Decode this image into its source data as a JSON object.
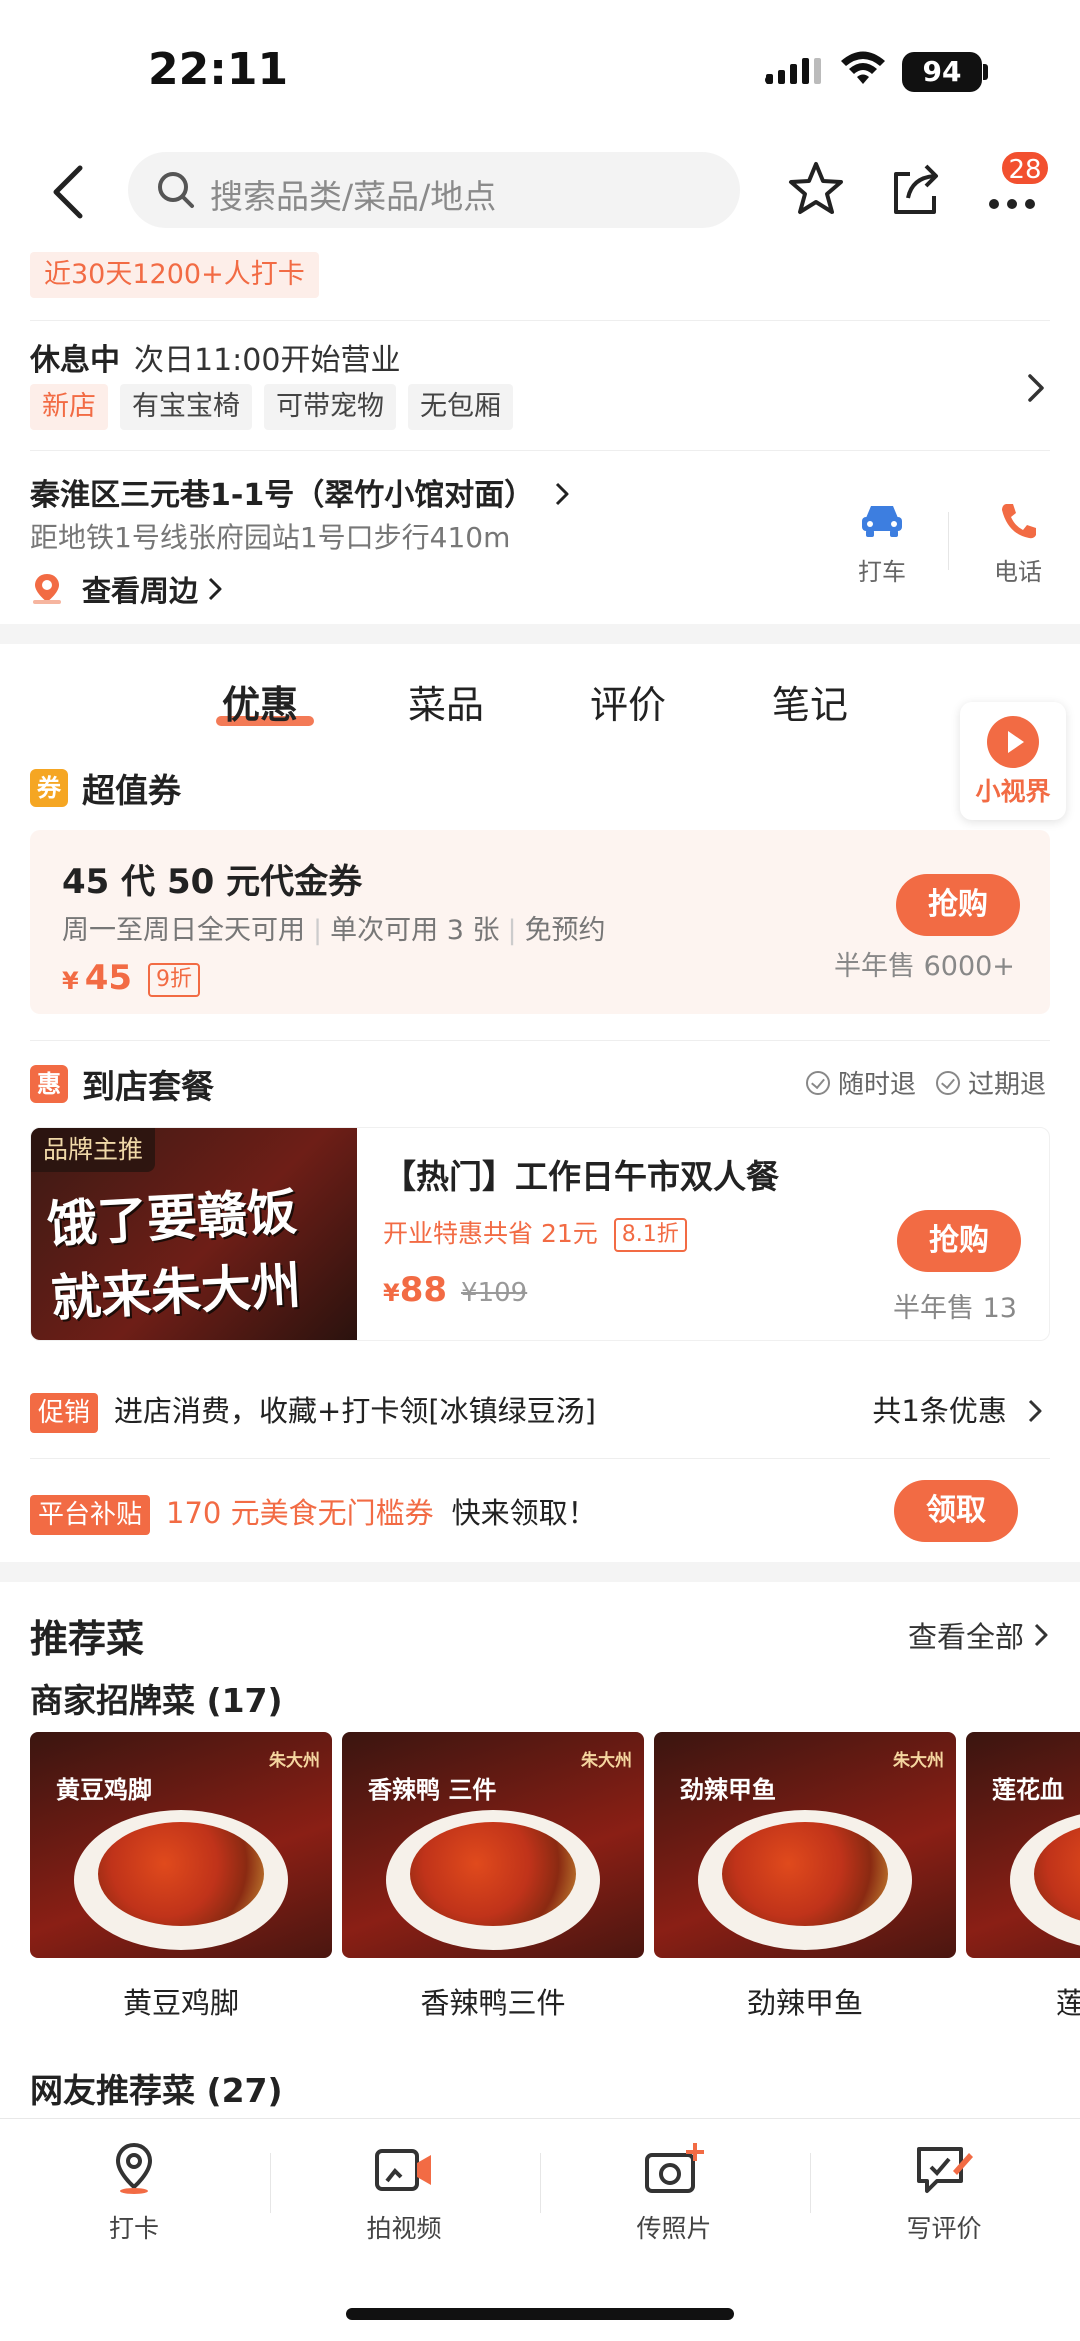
{
  "status_bar": {
    "time": "22:11",
    "battery": "94"
  },
  "nav": {
    "search_placeholder": "搜索品类/菜品/地点",
    "more_badge": "28"
  },
  "checkin_banner": "近30天1200+人打卡",
  "hours": {
    "status": "休息中",
    "next_open": "次日11:00开始营业",
    "tags": [
      "新店",
      "有宝宝椅",
      "可带宠物",
      "无包厢"
    ]
  },
  "location": {
    "address": "秦淮区三元巷1-1号（翠竹小馆对面）",
    "distance": "距地铁1号线张府园站1号口步行410m",
    "nearby": "查看周边",
    "taxi_label": "打车",
    "phone_label": "电话"
  },
  "tabs": [
    "优惠",
    "菜品",
    "评价",
    "笔记"
  ],
  "mini_world_label": "小视界",
  "voucher_section": {
    "icon": "券",
    "title": "超值券",
    "card": {
      "title": "45 代 50 元代金券",
      "meta": [
        "周一至周日全天可用",
        "单次可用 3 张",
        "免预约"
      ],
      "currency": "¥",
      "price": "45",
      "discount": "9折",
      "buy": "抢购",
      "sold": "半年售 6000+"
    }
  },
  "set_section": {
    "icon": "惠",
    "title": "到店套餐",
    "refund_any": "随时退",
    "refund_expired": "过期退",
    "card": {
      "badge": "品牌主推",
      "image_text": "饿了要赣饭 就来朱大州",
      "title": "【热门】工作日午市双人餐",
      "promo": "开业特惠共省 21元",
      "discount": "8.1折",
      "currency": "¥",
      "price": "88",
      "original": "¥109",
      "buy": "抢购",
      "sold": "半年售 13"
    }
  },
  "promo": {
    "pill": "促销",
    "text": "进店消费，收藏+打卡领[冰镇绿豆汤]",
    "count": "共1条优惠"
  },
  "subsidy": {
    "pill": "平台补贴",
    "highlight": "170 元美食无门槛券",
    "text": "快来领取！",
    "button": "领取"
  },
  "recommended": {
    "title": "推荐菜",
    "see_all": "查看全部",
    "signature_title": "商家招牌菜 (17)",
    "brand_logo": "朱大州",
    "dishes": [
      {
        "name": "黄豆鸡脚",
        "label": "黄豆鸡脚"
      },
      {
        "name": "香辣鸭三件",
        "label": "香辣鸭 三件"
      },
      {
        "name": "劲辣甲鱼",
        "label": "劲辣甲鱼"
      },
      {
        "name": "莲",
        "label": "莲花血"
      }
    ],
    "netizen_title": "网友推荐菜 (27)"
  },
  "bottom_bar": {
    "items": [
      "打卡",
      "拍视频",
      "传照片",
      "写评价"
    ]
  },
  "colors": {
    "accent": "#f26b44",
    "voucher_bg": "#fdf4f0"
  }
}
